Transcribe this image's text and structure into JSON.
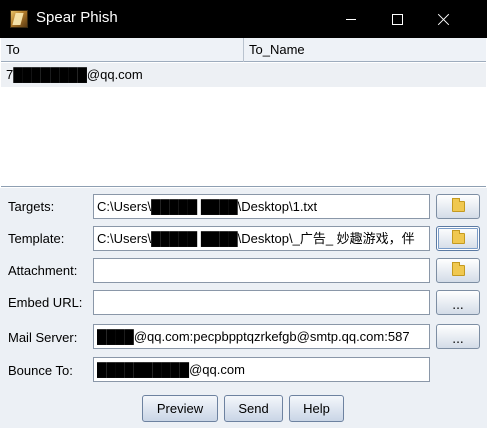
{
  "window": {
    "title": "Spear Phish"
  },
  "table": {
    "columns": [
      "To",
      "To_Name"
    ],
    "rows": [
      {
        "to": "7████████@qq.com",
        "to_name": ""
      }
    ]
  },
  "form": {
    "targets": {
      "label": "Targets:",
      "value": "C:\\Users\\█████ ████\\Desktop\\1.txt"
    },
    "template": {
      "label": "Template:",
      "value": "C:\\Users\\█████ ████\\Desktop\\_广告_ 妙趣游戏，伴"
    },
    "attachment": {
      "label": "Attachment:",
      "value": ""
    },
    "embed_url": {
      "label": "Embed URL:",
      "value": ""
    },
    "mail_server": {
      "label": "Mail Server:",
      "value": "████@qq.com:pecpbpptqzrkefgb@smtp.qq.com:587"
    },
    "bounce_to": {
      "label": "Bounce To:",
      "value": "██████████@qq.com"
    },
    "browse_dots": "..."
  },
  "actions": {
    "preview": "Preview",
    "send": "Send",
    "help": "Help"
  },
  "icons": {
    "app": "app-icon",
    "folder": "folder-icon"
  }
}
